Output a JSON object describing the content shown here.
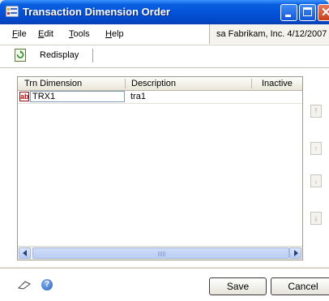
{
  "window": {
    "title": "Transaction Dimension Order"
  },
  "menubar": {
    "items": [
      "File",
      "Edit",
      "Tools",
      "Help"
    ],
    "company_info": "sa  Fabrikam, Inc.  4/12/2007"
  },
  "toolbar": {
    "redisplay_label": "Redisplay"
  },
  "grid": {
    "columns": [
      "Trn Dimension",
      "Description",
      "Inactive"
    ],
    "rows": [
      {
        "dimension": "TRX1",
        "description": "tra1",
        "inactive": ""
      }
    ]
  },
  "footer": {
    "save_label": "Save",
    "cancel_label": "Cancel"
  }
}
